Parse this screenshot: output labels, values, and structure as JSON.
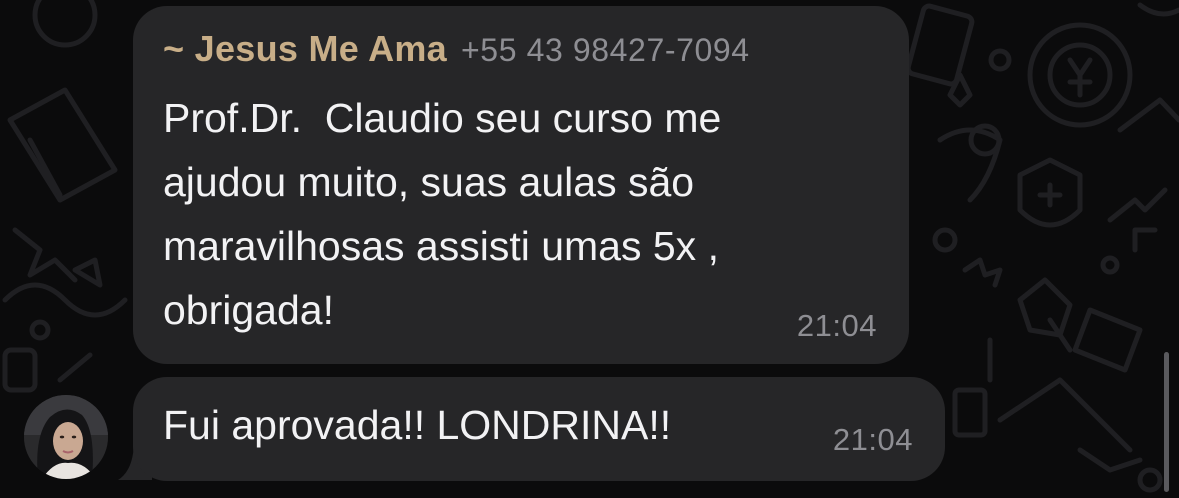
{
  "chat": {
    "messages": [
      {
        "sender_name": "~ Jesus Me Ama",
        "sender_phone": "+55 43 98427-7094",
        "text": "Prof.Dr.  Claudio seu curso me\najudou muito, suas aulas são\nmaravilhosas assisti umas 5x ,\nobrigada!",
        "time": "21:04"
      },
      {
        "text": "Fui aprovada!! LONDRINA!!",
        "time": "21:04"
      }
    ]
  },
  "colors": {
    "background": "#0b0b0c",
    "bubble": "#262628",
    "sender_name": "#c8ae88",
    "text": "#f2f2f4",
    "muted": "#8e8e93"
  },
  "icons": [
    "chat-wallpaper-doodles",
    "avatar-photo"
  ]
}
